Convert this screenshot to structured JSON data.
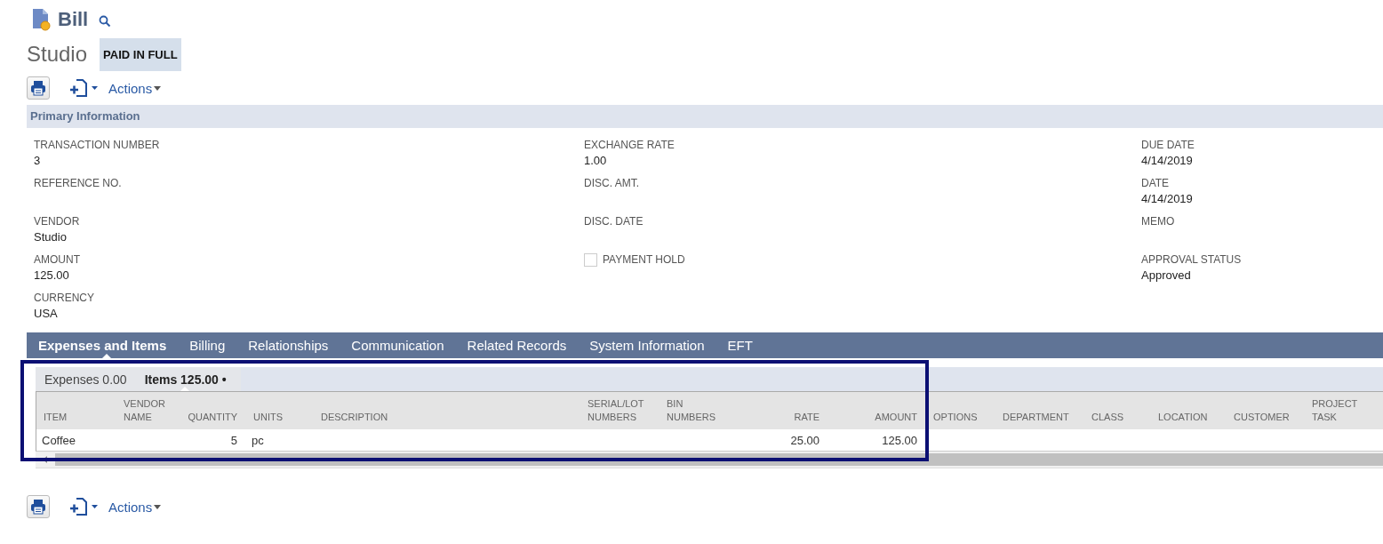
{
  "header": {
    "record_type": "Bill",
    "name": "Studio",
    "status": "PAID IN FULL"
  },
  "top_toolbar": {
    "actions_label": "Actions"
  },
  "primary_section": {
    "title": "Primary Information",
    "columns": [
      [
        {
          "kind": "field",
          "label": "TRANSACTION NUMBER",
          "value": "3"
        },
        {
          "kind": "field",
          "label": "REFERENCE NO."
        },
        {
          "kind": "field",
          "label": "VENDOR",
          "value": "Studio"
        },
        {
          "kind": "field",
          "label": "AMOUNT",
          "value": "125.00"
        },
        {
          "kind": "field",
          "label": "CURRENCY",
          "value": "USA"
        }
      ],
      [
        {
          "kind": "field",
          "label": "EXCHANGE RATE",
          "value": "1.00"
        },
        {
          "kind": "field",
          "label": "DISC. AMT."
        },
        {
          "kind": "field",
          "label": "DISC. DATE"
        },
        {
          "kind": "checkbox",
          "label": "PAYMENT HOLD",
          "checked": false
        }
      ],
      [
        {
          "kind": "field",
          "label": "DUE DATE",
          "value": "4/14/2019"
        },
        {
          "kind": "field",
          "label": "DATE",
          "value": "4/14/2019"
        },
        {
          "kind": "field",
          "label": "MEMO"
        },
        {
          "kind": "field",
          "label": "APPROVAL STATUS",
          "value": "Approved"
        }
      ]
    ]
  },
  "tabs": [
    {
      "label": "Expenses and Items",
      "selected": true
    },
    {
      "label": "Billing",
      "selected": false
    },
    {
      "label": "Relationships",
      "selected": false
    },
    {
      "label": "Communication",
      "selected": false
    },
    {
      "label": "Related Records",
      "selected": false
    },
    {
      "label": "System Information",
      "selected": false
    },
    {
      "label": "EFT",
      "selected": false
    }
  ],
  "subtabs": [
    {
      "label": "Expenses 0.00",
      "selected": false
    },
    {
      "label": "Items 125.00 •",
      "selected": true
    }
  ],
  "table": {
    "columns": [
      {
        "label": "ITEM",
        "kind": "text"
      },
      {
        "label": "VENDOR NAME",
        "kind": "text"
      },
      {
        "label": "QUANTITY",
        "kind": "number"
      },
      {
        "label": "UNITS",
        "kind": "text"
      },
      {
        "label": "DESCRIPTION",
        "kind": "text"
      },
      {
        "label": "SERIAL/LOT NUMBERS",
        "kind": "text"
      },
      {
        "label": "BIN NUMBERS",
        "kind": "text"
      },
      {
        "label": "RATE",
        "kind": "number"
      },
      {
        "label": "AMOUNT",
        "kind": "number"
      },
      {
        "label": "OPTIONS",
        "kind": "text"
      },
      {
        "label": "DEPARTMENT",
        "kind": "text"
      },
      {
        "label": "CLASS",
        "kind": "text"
      },
      {
        "label": "LOCATION",
        "kind": "text"
      },
      {
        "label": "CUSTOMER",
        "kind": "text"
      },
      {
        "label": "PROJECT TASK",
        "kind": "text"
      }
    ],
    "rows": [
      [
        "Coffee",
        null,
        "5",
        "pc",
        null,
        null,
        null,
        "25.00",
        "125.00",
        null,
        null,
        null,
        null,
        null,
        null
      ]
    ]
  },
  "bottom_toolbar": {
    "actions_label": "Actions"
  }
}
